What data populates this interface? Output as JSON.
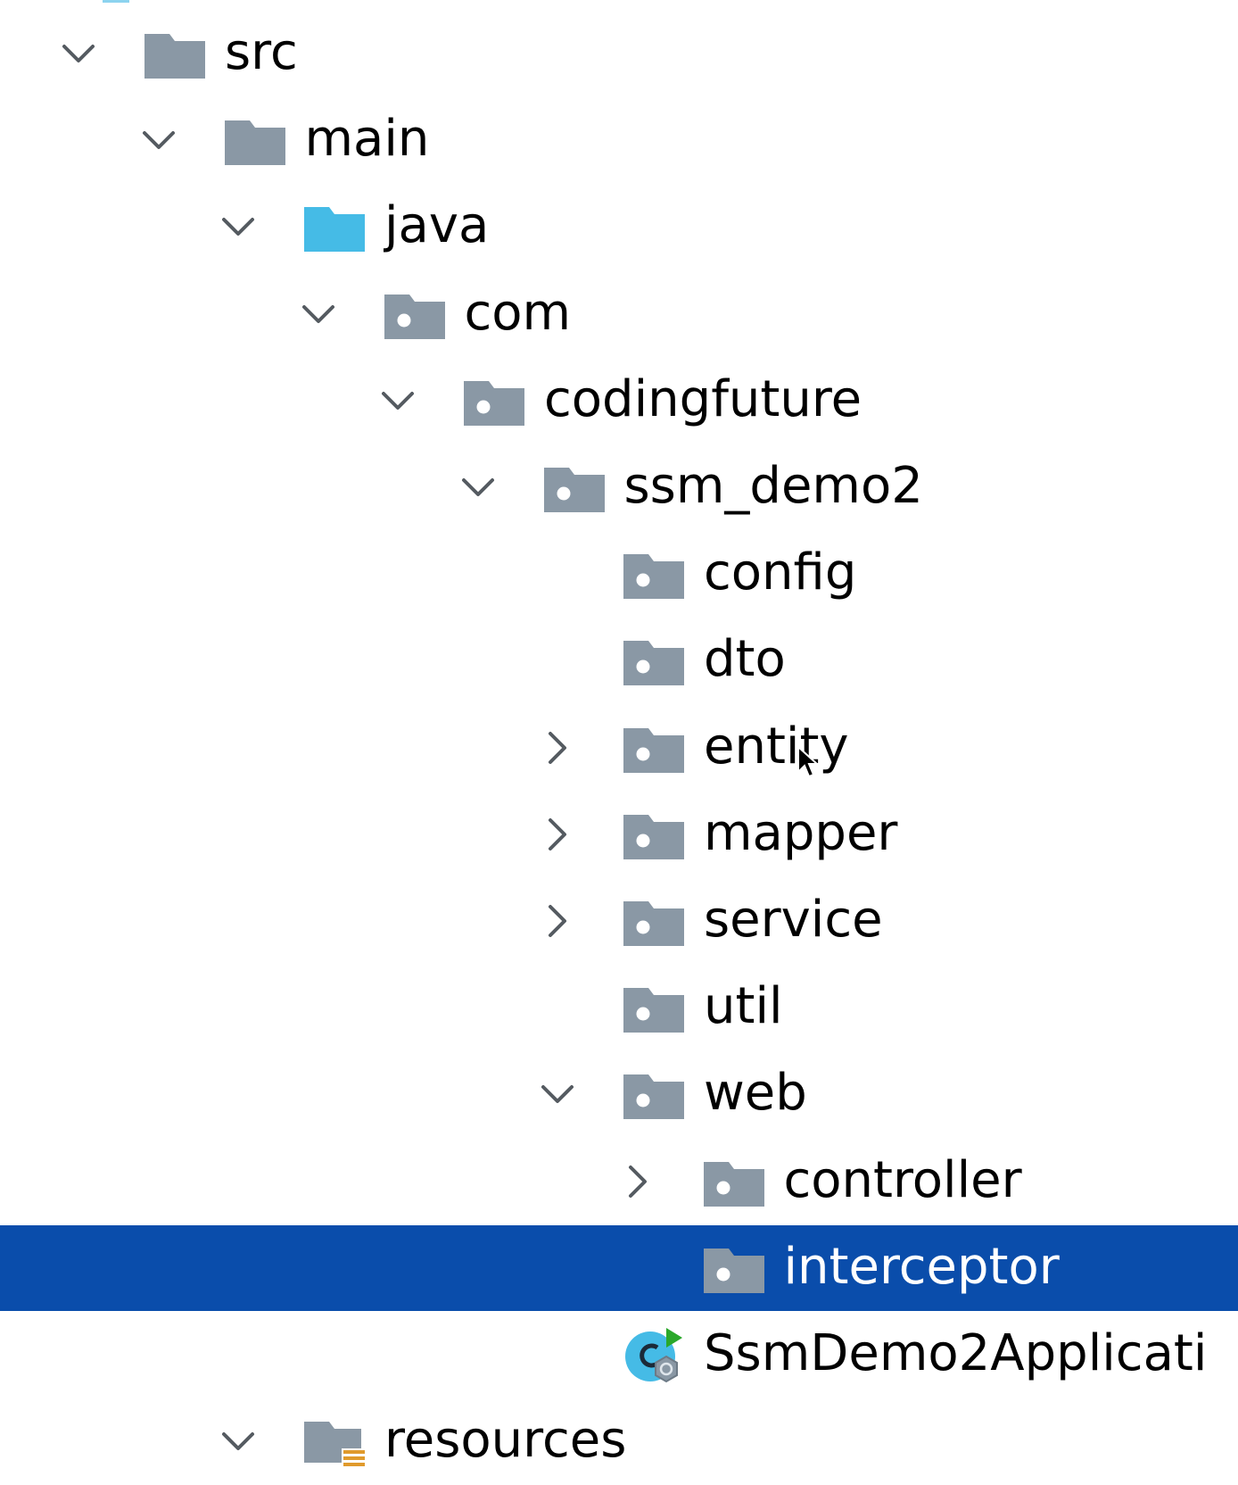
{
  "project_tree": {
    "selected": "interceptor",
    "items": [
      {
        "label": "src",
        "depth": 0,
        "expander": "expanded",
        "icon": "folder-source-root-gray-icon"
      },
      {
        "label": "main",
        "depth": 1,
        "expander": "expanded",
        "icon": "folder-gray-icon"
      },
      {
        "label": "java",
        "depth": 2,
        "expander": "expanded",
        "icon": "folder-sources-blue-icon"
      },
      {
        "label": "com",
        "depth": 3,
        "expander": "expanded",
        "icon": "package-icon"
      },
      {
        "label": "codingfuture",
        "depth": 4,
        "expander": "expanded",
        "icon": "package-icon"
      },
      {
        "label": "ssm_demo2",
        "depth": 5,
        "expander": "expanded",
        "icon": "package-icon"
      },
      {
        "label": "config",
        "depth": 6,
        "expander": "none",
        "icon": "package-icon"
      },
      {
        "label": "dto",
        "depth": 6,
        "expander": "none",
        "icon": "package-icon"
      },
      {
        "label": "entity",
        "depth": 6,
        "expander": "collapsed",
        "icon": "package-icon"
      },
      {
        "label": "mapper",
        "depth": 6,
        "expander": "collapsed",
        "icon": "package-icon"
      },
      {
        "label": "service",
        "depth": 6,
        "expander": "collapsed",
        "icon": "package-icon"
      },
      {
        "label": "util",
        "depth": 6,
        "expander": "none",
        "icon": "package-icon"
      },
      {
        "label": "web",
        "depth": 6,
        "expander": "expanded",
        "icon": "package-icon"
      },
      {
        "label": "controller",
        "depth": 7,
        "expander": "collapsed",
        "icon": "package-icon"
      },
      {
        "label": "interceptor",
        "depth": 7,
        "expander": "none",
        "icon": "package-icon"
      },
      {
        "label": "SsmDemo2Applicati",
        "depth": 6,
        "expander": "none",
        "icon": "spring-boot-application-class-icon"
      },
      {
        "label": "resources",
        "depth": 2,
        "expander": "expanded",
        "icon": "folder-resources-icon"
      }
    ]
  },
  "colors": {
    "selection_bg": "#0a4dab",
    "folder_gray": "#8a98a5",
    "folder_blue": "#45bbe6",
    "chevron": "#555b61",
    "resources_stripes": "#e09a2c",
    "spring_green": "#2aa82a"
  }
}
